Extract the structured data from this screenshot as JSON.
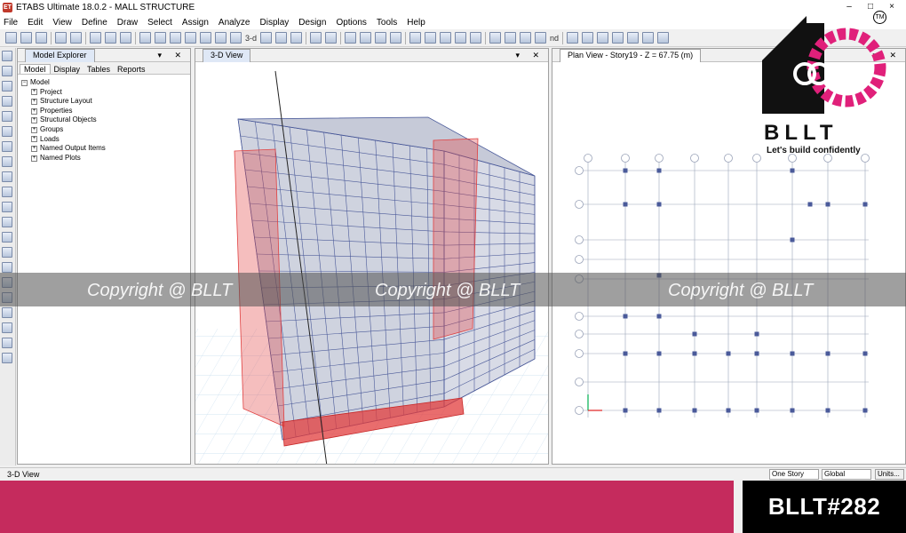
{
  "window": {
    "app_icon_text": "ET",
    "title": "ETABS Ultimate 18.0.2 - MALL STRUCTURE",
    "controls": [
      "–",
      "□",
      "×"
    ]
  },
  "menu": [
    "File",
    "Edit",
    "View",
    "Define",
    "Draw",
    "Select",
    "Assign",
    "Analyze",
    "Display",
    "Design",
    "Options",
    "Tools",
    "Help"
  ],
  "toolbar": {
    "view_3d_label": "3-d",
    "nd_label": "nd"
  },
  "model_explorer": {
    "title": "Model Explorer",
    "tabs": [
      "Model",
      "Display",
      "Tables",
      "Reports"
    ],
    "root": "Model",
    "items": [
      "Project",
      "Structure Layout",
      "Properties",
      "Structural Objects",
      "Groups",
      "Loads",
      "Named Output Items",
      "Named Plots"
    ]
  },
  "view3d": {
    "tab_label": "3-D View"
  },
  "plan_view": {
    "tab_label": "Plan View - Story19 - Z = 67.75 (m)"
  },
  "status": {
    "left": "3-D View",
    "story_select": "One Story",
    "coord_select": "Global",
    "units_button": "Units..."
  },
  "watermark": {
    "text": "Copyright @ BLLT"
  },
  "logo": {
    "name": "BLLT",
    "tagline": "Let's build confidently",
    "tm": "TM"
  },
  "tag": "BLLT#282",
  "colors": {
    "banner": "#c52b5d",
    "logo_accent": "#e0207a",
    "frame": "#4a5a9a",
    "shear_wall": "#e04040"
  }
}
